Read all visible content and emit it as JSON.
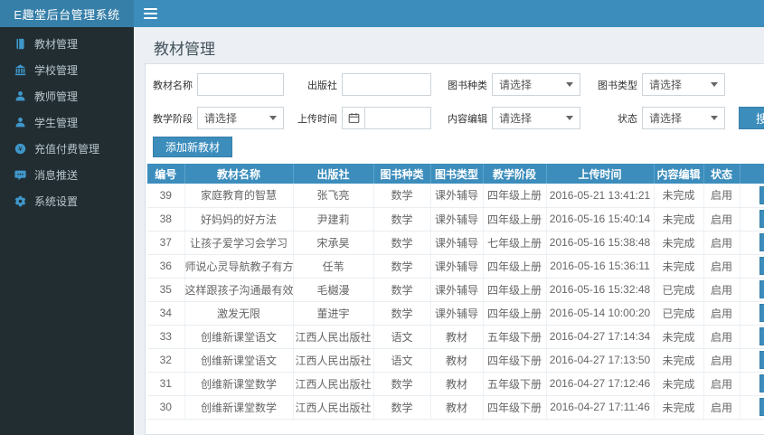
{
  "app": {
    "title": "E趣堂后台管理系统"
  },
  "page": {
    "title": "教材管理"
  },
  "colors": {
    "navbar": "#3c8dbc",
    "logo_bg": "#367fa9",
    "sidebar_bg": "#222d32",
    "sidebar_text": "#b8c7ce",
    "sidebar_icon": "#3f97c9",
    "accent_button": "#3c8dbc",
    "table_header_bg": "#3c8dbc",
    "content_bg": "#ecf0f5"
  },
  "sidebar": {
    "items": [
      {
        "icon": "book-icon",
        "label": "教材管理"
      },
      {
        "icon": "school-icon",
        "label": "学校管理"
      },
      {
        "icon": "teacher-icon",
        "label": "教师管理"
      },
      {
        "icon": "student-icon",
        "label": "学生管理"
      },
      {
        "icon": "money-icon",
        "label": "充值付费管理"
      },
      {
        "icon": "message-icon",
        "label": "消息推送"
      },
      {
        "icon": "gear-icon",
        "label": "系统设置"
      }
    ]
  },
  "filters": {
    "material_name": {
      "label": "教材名称",
      "value": ""
    },
    "publisher": {
      "label": "出版社",
      "value": ""
    },
    "book_category": {
      "label": "图书种类",
      "value": "请选择"
    },
    "book_type": {
      "label": "图书类型",
      "value": "请选择"
    },
    "teaching_stage": {
      "label": "教学阶段",
      "value": "请选择"
    },
    "upload_time": {
      "label": "上传时间",
      "value": ""
    },
    "content_edit": {
      "label": "内容编辑",
      "value": "请选择"
    },
    "status": {
      "label": "状态",
      "value": "请选择"
    },
    "search_label": "搜索"
  },
  "toolbar": {
    "add_label": "添加新教材"
  },
  "table": {
    "headers": [
      "编号",
      "教材名称",
      "出版社",
      "图书种类",
      "图书类型",
      "教学阶段",
      "上传时间",
      "内容编辑",
      "状态"
    ],
    "rows": [
      [
        "39",
        "家庭教育的智慧",
        "张飞亮",
        "数学",
        "课外辅导",
        "四年级上册",
        "2016-05-21 13:41:21",
        "未完成",
        "启用"
      ],
      [
        "38",
        "好妈妈的好方法",
        "尹建莉",
        "数学",
        "课外辅导",
        "四年级上册",
        "2016-05-16 15:40:14",
        "未完成",
        "启用"
      ],
      [
        "37",
        "让孩子爱学习会学习",
        "宋承昊",
        "数学",
        "课外辅导",
        "七年级上册",
        "2016-05-16 15:38:48",
        "未完成",
        "启用"
      ],
      [
        "36",
        "师说心灵导航教子有方",
        "任苇",
        "数学",
        "课外辅导",
        "四年级上册",
        "2016-05-16 15:36:11",
        "未完成",
        "启用"
      ],
      [
        "35",
        "这样跟孩子沟通最有效",
        "毛樾漫",
        "数学",
        "课外辅导",
        "四年级上册",
        "2016-05-16 15:32:48",
        "已完成",
        "启用"
      ],
      [
        "34",
        "激发无限",
        "董进宇",
        "数学",
        "课外辅导",
        "四年级上册",
        "2016-05-14 10:00:20",
        "已完成",
        "启用"
      ],
      [
        "33",
        "创维新课堂语文",
        "江西人民出版社",
        "语文",
        "教材",
        "五年级下册",
        "2016-04-27 17:14:34",
        "未完成",
        "启用"
      ],
      [
        "32",
        "创维新课堂语文",
        "江西人民出版社",
        "语文",
        "教材",
        "四年级下册",
        "2016-04-27 17:13:50",
        "未完成",
        "启用"
      ],
      [
        "31",
        "创维新课堂数学",
        "江西人民出版社",
        "数学",
        "教材",
        "五年级下册",
        "2016-04-27 17:12:46",
        "未完成",
        "启用"
      ],
      [
        "30",
        "创维新课堂数学",
        "江西人民出版社",
        "数学",
        "教材",
        "四年级下册",
        "2016-04-27 17:11:46",
        "未完成",
        "启用"
      ]
    ]
  }
}
